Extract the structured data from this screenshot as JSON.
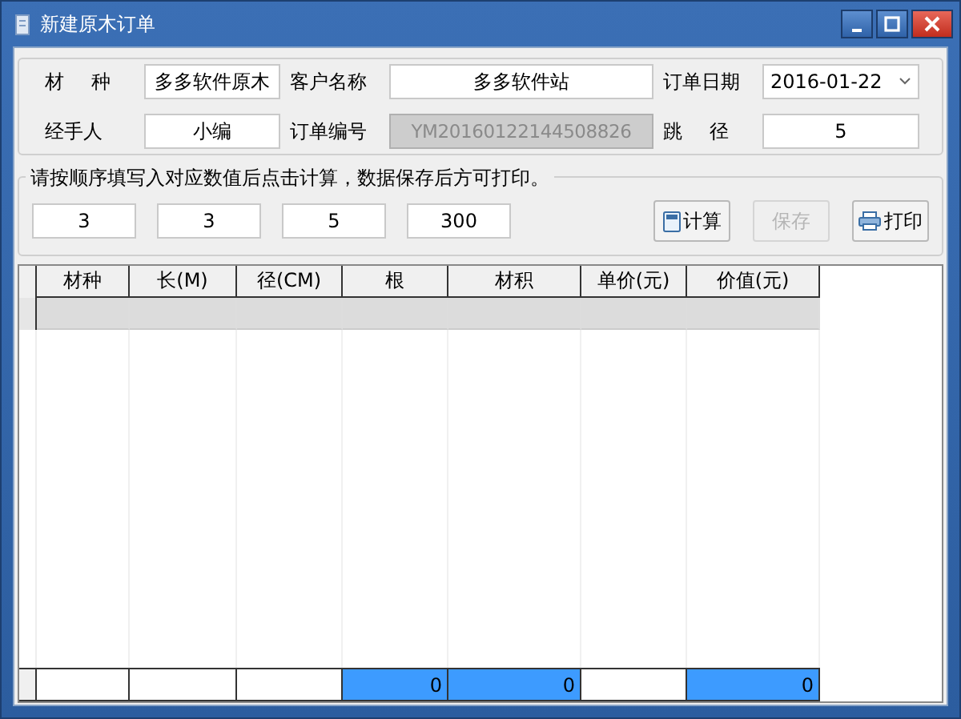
{
  "window": {
    "title": "新建原木订单"
  },
  "form": {
    "rows": [
      [
        {
          "label": "材 种",
          "value": "多多软件原木",
          "kind": "text"
        },
        {
          "label": "客户名称",
          "value": "多多软件站",
          "kind": "text"
        },
        {
          "label": "订单日期",
          "value": "2016-01-22",
          "kind": "date"
        }
      ],
      [
        {
          "label": "经手人",
          "value": "小编",
          "kind": "text"
        },
        {
          "label": "订单编号",
          "value": "YM20160122144508826",
          "kind": "readonly"
        },
        {
          "label": "跳 径",
          "value": "5",
          "kind": "text"
        }
      ]
    ]
  },
  "calc": {
    "legend": "请按顺序填写入对应数值后点击计算，数据保存后方可打印。",
    "inputs": [
      "3",
      "3",
      "5",
      "300"
    ],
    "buttons": [
      {
        "label": "计算",
        "kind": "calc",
        "disabled": false
      },
      {
        "label": "保存",
        "kind": "save",
        "disabled": true
      },
      {
        "label": "打印",
        "kind": "print",
        "disabled": false
      }
    ]
  },
  "table": {
    "columns": [
      "材种",
      "长(M)",
      "径(CM)",
      "根",
      "材积",
      "单价(元)",
      "价值(元)"
    ],
    "rows": [
      {
        "selected": true
      }
    ],
    "footer": [
      {
        "highlight": false
      },
      {
        "highlight": false
      },
      {
        "highlight": false
      },
      {
        "value": "0",
        "highlight": true
      },
      {
        "value": "0",
        "highlight": true
      },
      {
        "highlight": false
      },
      {
        "value": "0",
        "highlight": true
      }
    ]
  }
}
